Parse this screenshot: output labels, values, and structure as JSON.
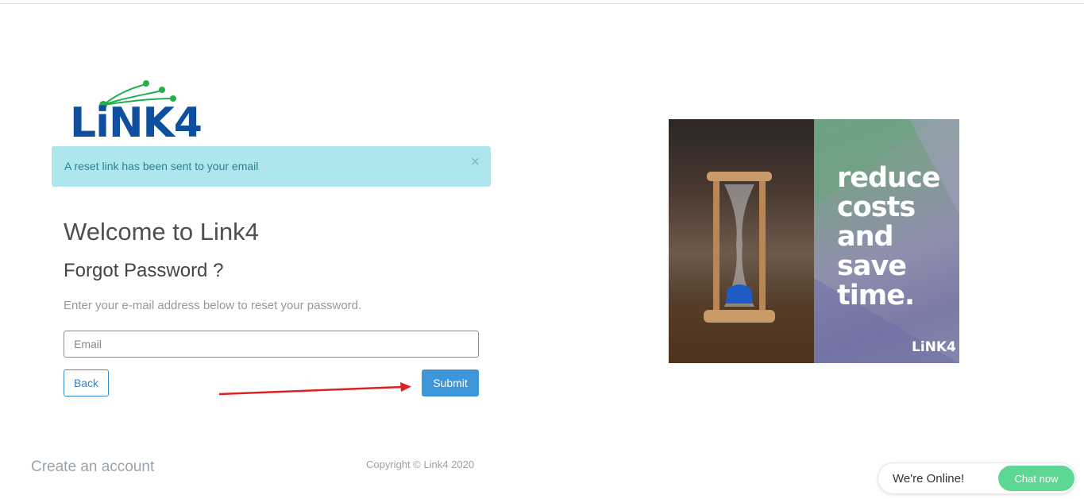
{
  "logo": {
    "text": "LiNK4",
    "brand_color": "#0f4fa0",
    "accent_color": "#22b04b"
  },
  "alert": {
    "message": "A reset link has been sent to your email",
    "close": "×"
  },
  "heading": "Welcome to Link4",
  "subheading": "Forgot Password ?",
  "instruction": "Enter your e-mail address below to reset your password.",
  "email_field": {
    "value": "",
    "placeholder": "Email"
  },
  "buttons": {
    "back": "Back",
    "submit": "Submit"
  },
  "footer": {
    "create_account": "Create an account",
    "copyright": "Copyright © Link4 2020"
  },
  "promo": {
    "lines": [
      "reduce",
      "costs",
      "and",
      "save",
      "time."
    ],
    "logo_text": "LiNK4"
  },
  "chat": {
    "status": "We're Online!",
    "button": "Chat now",
    "button_color": "#5dd794"
  },
  "colors": {
    "primary": "#3d95da",
    "alert_bg": "#aee6ee",
    "alert_text": "#2a8193",
    "arrow": "#e02020"
  }
}
